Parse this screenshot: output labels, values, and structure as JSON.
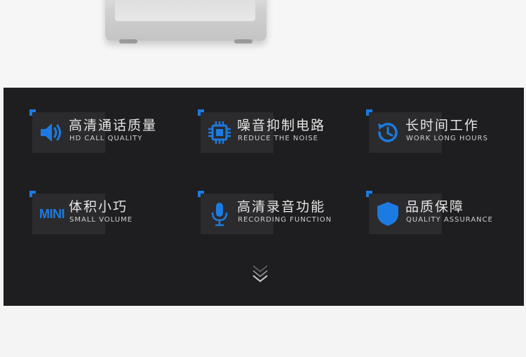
{
  "accent_color": "#1c7be0",
  "features": [
    {
      "title_cn": "高清通话质量",
      "title_en": "HD CALL QUALITY",
      "icon": "speaker-icon"
    },
    {
      "title_cn": "噪音抑制电路",
      "title_en": "REDUCE THE NOISE",
      "icon": "chip-icon"
    },
    {
      "title_cn": "长时间工作",
      "title_en": "WORK LONG HOURS",
      "icon": "clock-history-icon"
    },
    {
      "title_cn": "体积小巧",
      "title_en": "SMALL VOLUME",
      "icon": "mini-text-icon",
      "icon_text": "MINI"
    },
    {
      "title_cn": "高清录音功能",
      "title_en": "RECORDING FUNCTION",
      "icon": "microphone-icon"
    },
    {
      "title_cn": "品质保障",
      "title_en": "QUALITY ASSURANCE",
      "icon": "shield-icon"
    }
  ]
}
